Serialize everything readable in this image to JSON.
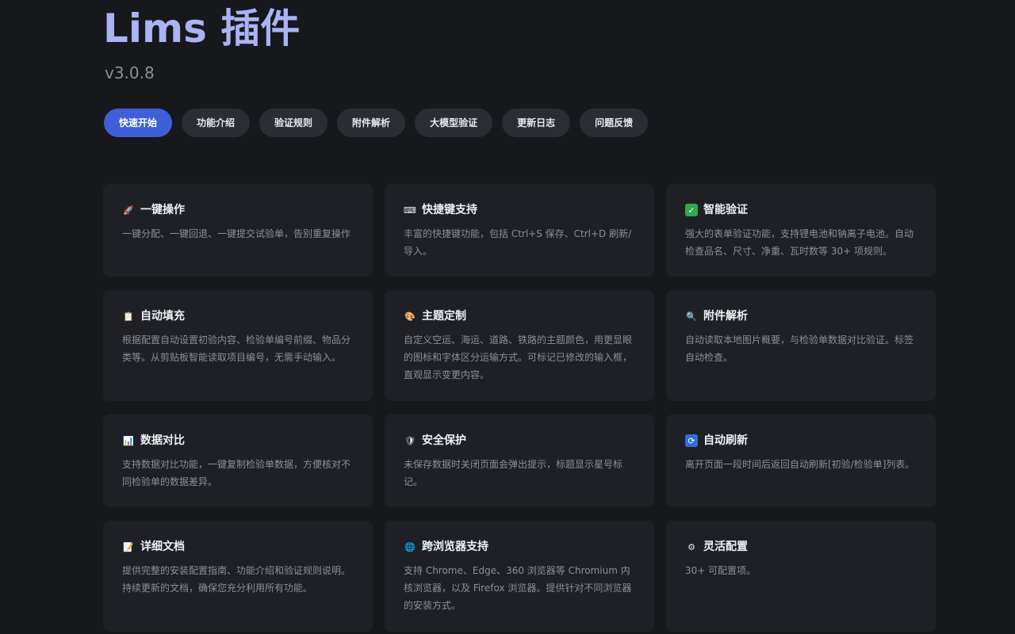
{
  "header": {
    "title": "Lims 插件",
    "version": "v3.0.8"
  },
  "tabs": [
    {
      "label": "快速开始",
      "active": true
    },
    {
      "label": "功能介绍"
    },
    {
      "label": "验证规则"
    },
    {
      "label": "附件解析"
    },
    {
      "label": "大模型验证"
    },
    {
      "label": "更新日志"
    },
    {
      "label": "问题反馈"
    }
  ],
  "features": [
    {
      "icon": "rocket-icon",
      "title": "一键操作",
      "desc": "一键分配、一键回退、一键提交试验单，告别重复操作"
    },
    {
      "icon": "keyboard-icon",
      "title": "快捷键支持",
      "desc": "丰富的快捷键功能，包括 Ctrl+S 保存、Ctrl+D 刷新/导入。"
    },
    {
      "icon": "checkmark-icon",
      "title": "智能验证",
      "desc": "强大的表单验证功能，支持锂电池和钠离子电池。自动检查品名、尺寸、净重、瓦时数等 30+ 项规则。"
    },
    {
      "icon": "clipboard-icon",
      "title": "自动填充",
      "desc": "根据配置自动设置初验内容、检验单编号前缀、物品分类等。从剪贴板智能读取项目编号，无需手动输入。"
    },
    {
      "icon": "palette-icon",
      "title": "主题定制",
      "desc": "自定义空运、海运、道路、铁路的主题颜色，用更显眼的图标和字体区分运输方式。可标记已修改的输入框，直观显示变更内容。"
    },
    {
      "icon": "magnifier-icon",
      "title": "附件解析",
      "desc": "自动读取本地图片概要，与检验单数据对比验证。标签自动检查。"
    },
    {
      "icon": "bar-chart-icon",
      "title": "数据对比",
      "desc": "支持数据对比功能，一键复制检验单数据，方便核对不同检验单的数据差异。"
    },
    {
      "icon": "shield-icon",
      "title": "安全保护",
      "desc": "未保存数据时关闭页面会弹出提示，标题显示星号标记。"
    },
    {
      "icon": "refresh-icon",
      "title": "自动刷新",
      "desc": "离开页面一段时间后返回自动刷新[初验/检验单]列表。"
    },
    {
      "icon": "memo-icon",
      "title": "详细文档",
      "desc": "提供完整的安装配置指南、功能介绍和验证规则说明。持续更新的文档，确保您充分利用所有功能。"
    },
    {
      "icon": "globe-icon",
      "title": "跨浏览器支持",
      "desc": "支持 Chrome、Edge、360 浏览器等 Chromium 内核浏览器，以及 Firefox 浏览器。提供针对不同浏览器的安装方式。"
    },
    {
      "icon": "gear-icon",
      "title": "灵活配置",
      "desc": "30+ 可配置项。"
    }
  ]
}
